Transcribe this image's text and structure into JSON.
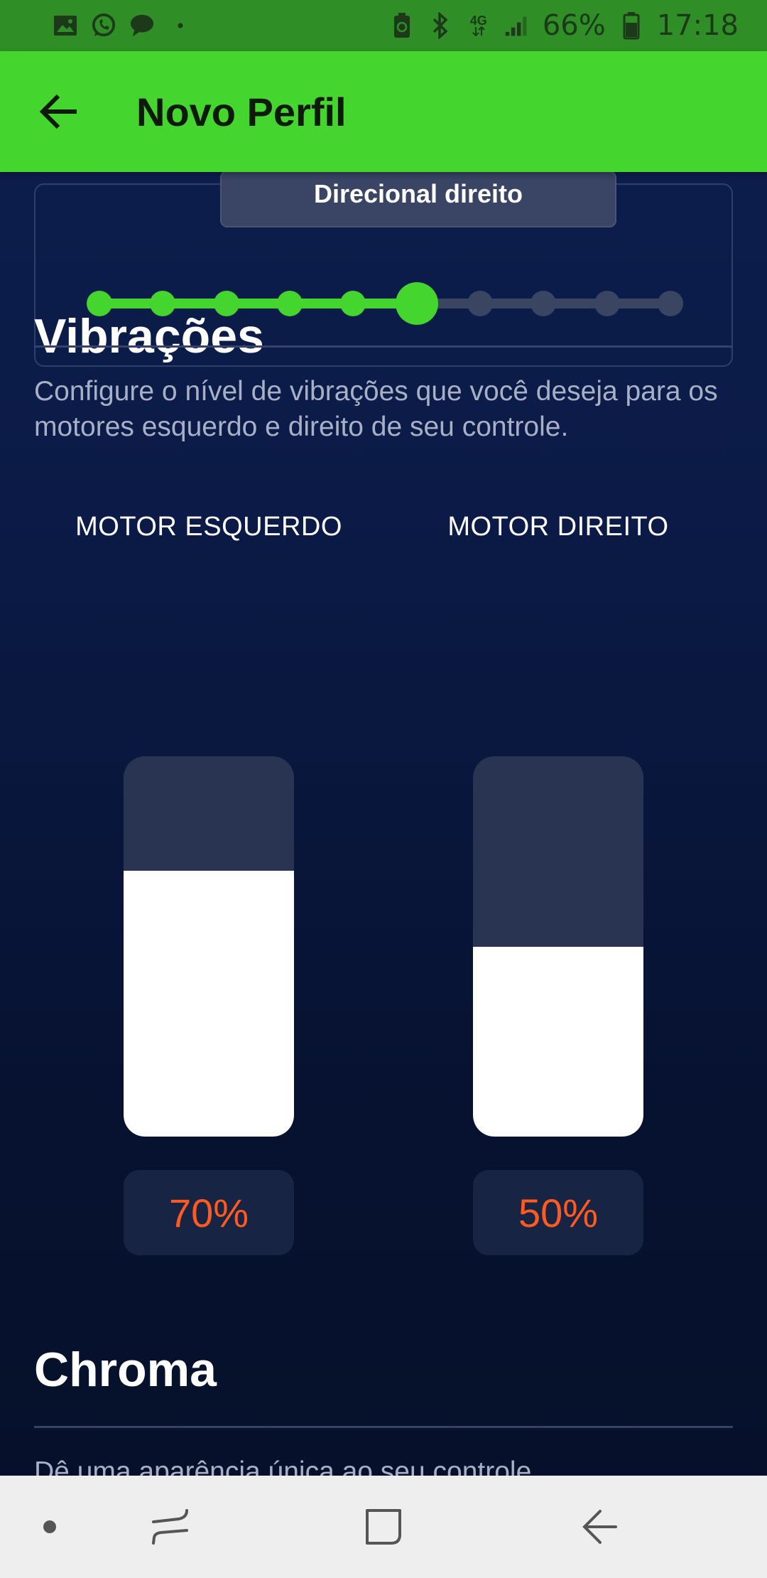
{
  "status_bar": {
    "battery": "66%",
    "time": "17:18",
    "network": "4G",
    "left_icons": [
      "gallery-icon",
      "whatsapp-icon",
      "chat-bubble-icon",
      "dot-icon"
    ],
    "right_icons": [
      "battery-saver-icon",
      "bluetooth-icon",
      "network-4g-icon",
      "signal-icon",
      "battery-icon"
    ]
  },
  "app_bar": {
    "title": "Novo Perfil",
    "back_icon": "arrow-left-icon"
  },
  "slider": {
    "tooltip": "Direcional direito",
    "steps": 10,
    "current_step": 6
  },
  "vibrations": {
    "title": "Vibrações",
    "description": "Configure o nível de vibrações que você deseja para os motores esquerdo e direito de seu controle.",
    "motors": [
      {
        "label": "MOTOR ESQUERDO",
        "value": 70,
        "value_text": "70%"
      },
      {
        "label": "MOTOR DIREITO",
        "value": 50,
        "value_text": "50%"
      }
    ]
  },
  "chroma": {
    "title": "Chroma",
    "description": "Dê uma aparência única ao seu controle"
  },
  "colors": {
    "accent": "#44d52e",
    "status_bar": "#2f8e26",
    "value_text": "#ff5a1f"
  },
  "nav_bar": {
    "items": [
      "dot-icon",
      "recent-apps-icon",
      "home-icon",
      "back-icon"
    ]
  }
}
